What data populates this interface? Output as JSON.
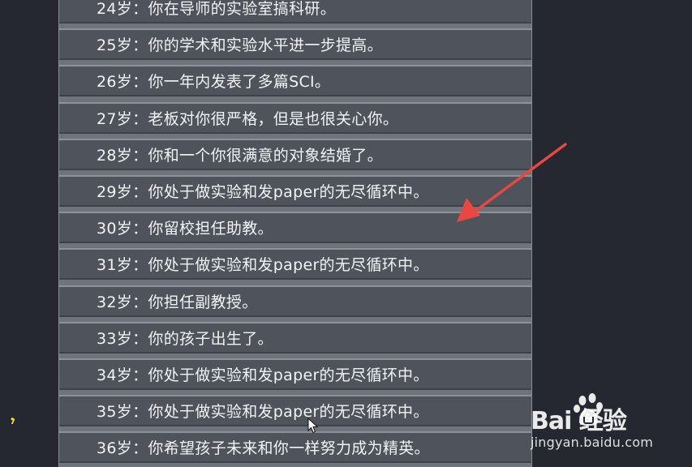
{
  "life_events": [
    {
      "age": "24岁：",
      "text": "你在导师的实验室搞科研。"
    },
    {
      "age": "25岁：",
      "text": "你的学术和实验水平进一步提高。"
    },
    {
      "age": "26岁：",
      "text": "你一年内发表了多篇SCI。"
    },
    {
      "age": "27岁：",
      "text": "老板对你很严格，但是也很关心你。"
    },
    {
      "age": "28岁：",
      "text": "你和一个你很满意的对象结婚了。"
    },
    {
      "age": "29岁：",
      "text": "你处于做实验和发paper的无尽循环中。"
    },
    {
      "age": "30岁：",
      "text": "你留校担任助教。"
    },
    {
      "age": "31岁：",
      "text": "你处于做实验和发paper的无尽循环中。"
    },
    {
      "age": "32岁：",
      "text": "你担任副教授。"
    },
    {
      "age": "33岁：",
      "text": "你的孩子出生了。"
    },
    {
      "age": "34岁：",
      "text": "你处于做实验和发paper的无尽循环中。"
    },
    {
      "age": "35岁：",
      "text": "你处于做实验和发paper的无尽循环中。"
    },
    {
      "age": "36岁：",
      "text": "你希望孩子未来和你一样努力成为精英。"
    }
  ],
  "watermark": {
    "brand": "Bai  经验",
    "url": "jingyan.baidu.com"
  },
  "colors": {
    "background": "#252830",
    "row_fill": "#4e535c",
    "row_highlight": "#8d9199",
    "text": "#f2f3f5",
    "arrow": "#e8483f"
  },
  "icons": {
    "cursor": "mouse-pointer-icon",
    "arrow": "red-annotation-arrow-icon",
    "paw": "baidu-paw-icon"
  }
}
